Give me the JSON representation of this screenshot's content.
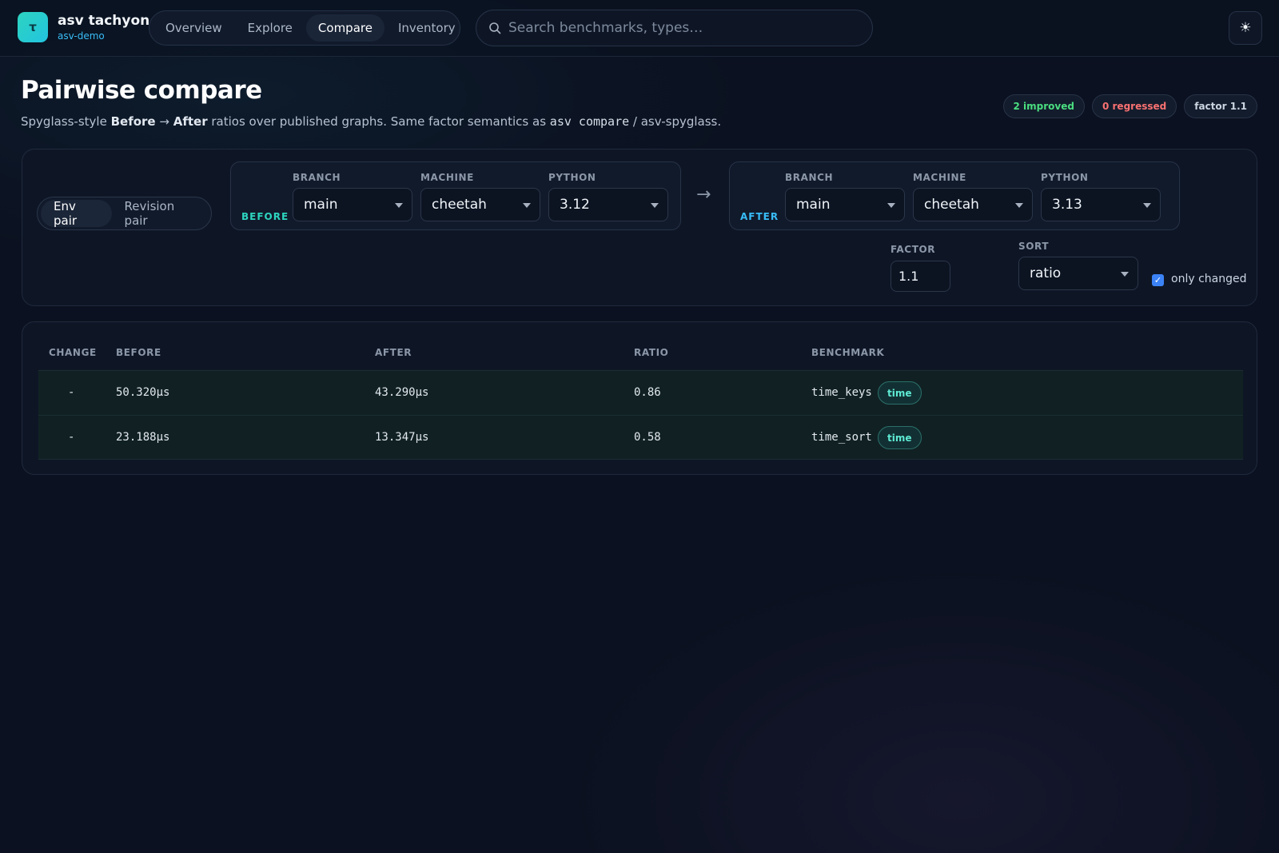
{
  "app": {
    "logo_glyph": "τ",
    "name": "asv tachyon",
    "project": "asv-demo"
  },
  "nav": {
    "tabs": [
      {
        "label": "Overview"
      },
      {
        "label": "Explore"
      },
      {
        "label": "Compare",
        "active": true
      },
      {
        "label": "Inventory"
      }
    ]
  },
  "search": {
    "placeholder": "Search benchmarks, types…",
    "value": ""
  },
  "theme_toggle": {
    "icon": "sun-icon",
    "glyph": "☀"
  },
  "header": {
    "title": "Pairwise compare",
    "subtitle": {
      "prefix": "Spyglass-style ",
      "before": "Before",
      "arrow": " → ",
      "after": "After",
      "middle": " ratios over published graphs. Same factor semantics as ",
      "code": "asv compare",
      "suffix": " / asv-spyglass."
    },
    "badges": {
      "improved": "2 improved",
      "regressed": "0 regressed",
      "factor": "factor 1.1"
    }
  },
  "controls": {
    "mode": {
      "options": [
        "Env pair",
        "Revision pair"
      ],
      "selected": "Env pair"
    },
    "before": {
      "tag": "BEFORE",
      "branch_label": "BRANCH",
      "branch": "main",
      "machine_label": "MACHINE",
      "machine": "cheetah",
      "python_label": "PYTHON",
      "python": "3.12"
    },
    "arrow": "→",
    "after": {
      "tag": "AFTER",
      "branch_label": "BRANCH",
      "branch": "main",
      "machine_label": "MACHINE",
      "machine": "cheetah",
      "python_label": "PYTHON",
      "python": "3.13"
    },
    "factor_label": "FACTOR",
    "factor": "1.1",
    "sort_label": "SORT",
    "sort": "ratio",
    "only_changed_label": "only changed",
    "only_changed": true
  },
  "table": {
    "columns": [
      "CHANGE",
      "BEFORE",
      "AFTER",
      "RATIO",
      "BENCHMARK"
    ],
    "rows": [
      {
        "change": "-",
        "before": "50.320μs",
        "after": "43.290μs",
        "ratio": "0.86",
        "benchmark": "time_keys",
        "type": "time"
      },
      {
        "change": "-",
        "before": "23.188μs",
        "after": "13.347μs",
        "ratio": "0.58",
        "benchmark": "time_sort",
        "type": "time"
      }
    ]
  },
  "colors": {
    "background": "#0b1120",
    "accent_teal": "#2dd4bf",
    "accent_blue": "#38bdf8",
    "improved": "#4ade80",
    "regressed": "#f87171",
    "checkbox": "#3b82f6"
  }
}
